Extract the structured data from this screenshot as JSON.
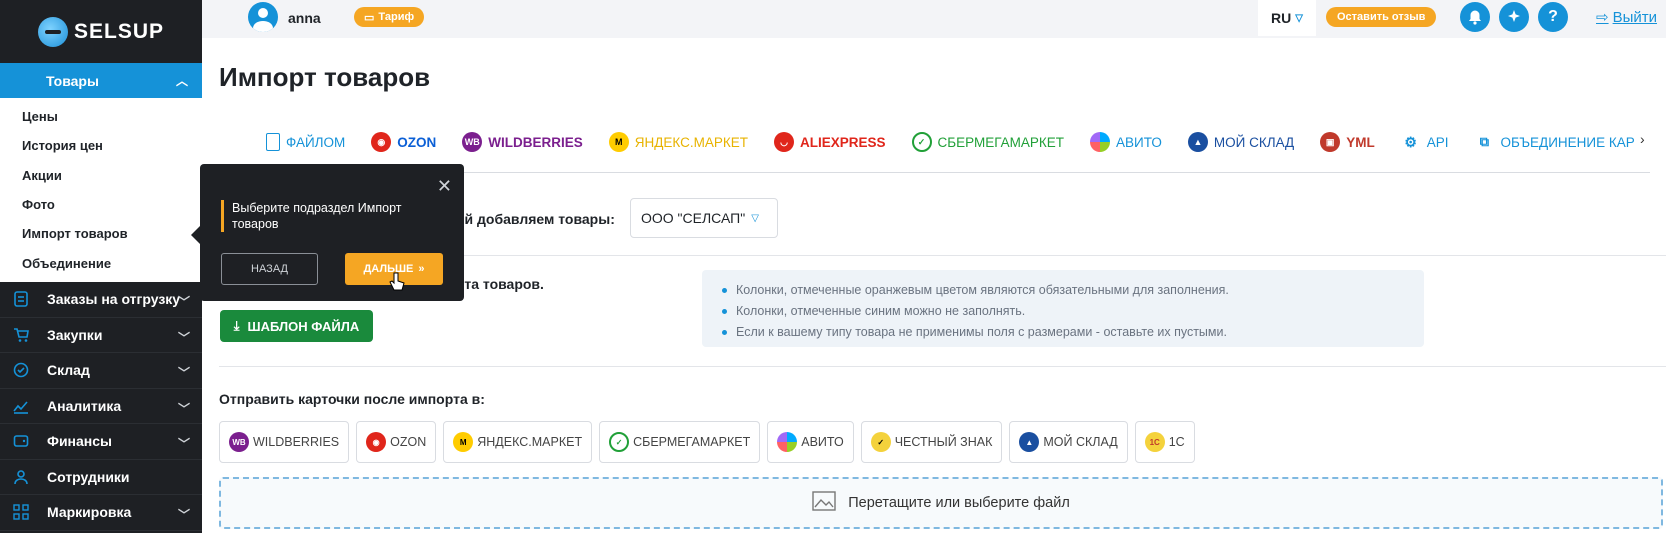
{
  "brand": {
    "name": "SELSUP"
  },
  "sidebar": {
    "active": {
      "label": "Товары"
    },
    "submenu": [
      "Цены",
      "История цен",
      "Акции",
      "Фото",
      "Импорт товаров",
      "Объединение"
    ],
    "items": [
      {
        "label": "Заказы на отгрузку",
        "icon": "orders-icon"
      },
      {
        "label": "Закупки",
        "icon": "cart-icon"
      },
      {
        "label": "Склад",
        "icon": "warehouse-icon"
      },
      {
        "label": "Аналитика",
        "icon": "analytics-icon"
      },
      {
        "label": "Финансы",
        "icon": "wallet-icon"
      },
      {
        "label": "Сотрудники",
        "icon": "user-icon"
      },
      {
        "label": "Маркировка",
        "icon": "marking-icon"
      }
    ]
  },
  "topbar": {
    "username": "anna",
    "tariff_label": "Тариф",
    "lang": "RU",
    "review_label": "Оставить отзыв",
    "logout_label": "Выйти"
  },
  "page": {
    "title": "Импорт товаров",
    "tabs": [
      {
        "label": "ФАЙЛОМ",
        "color": "#1592d8",
        "icon": "file-icon"
      },
      {
        "label": "OZON",
        "color": "#0b5fd6",
        "icon": "ozon-icon"
      },
      {
        "label": "WILDBERRIES",
        "color": "#7b1f8e",
        "icon": "wildberries-icon"
      },
      {
        "label": "ЯНДЕКС.МАРКЕТ",
        "color": "#e8b300",
        "icon": "yandex-market-icon"
      },
      {
        "label": "ALIEXPRESS",
        "color": "#e0261b",
        "icon": "aliexpress-icon"
      },
      {
        "label": "СБЕРМЕГАМАРКЕТ",
        "color": "#21a038",
        "icon": "sbermegamarket-icon"
      },
      {
        "label": "АВИТО",
        "color": "#1592d8",
        "icon": "avito-icon"
      },
      {
        "label": "МОЙ СКЛАД",
        "color": "#1a4fa0",
        "icon": "moysklad-icon"
      },
      {
        "label": "YML",
        "color": "#c0392b",
        "icon": "yml-icon"
      },
      {
        "label": "API",
        "color": "#1592d8",
        "icon": "api-icon"
      },
      {
        "label": "ОБЪЕДИНЕНИЕ КАР",
        "color": "#1592d8",
        "icon": "merge-icon"
      }
    ],
    "org_label": "ой добавляем товары:",
    "org_value": "ООО \"СЕЛСАП\"",
    "template_label": "рта товаров.",
    "template_button": "ШАБЛОН ФАЙЛА",
    "info": [
      "Колонки, отмеченные оранжевым цветом являются обязательными для заполнения.",
      "Колонки, отмеченные синим можно не заполнять.",
      "Если к вашему типу товара не применимы поля с размерами - оставьте их пустыми."
    ],
    "send_label": "Отправить карточки после импорта в:",
    "send_targets": [
      {
        "label": "WILDBERRIES",
        "icon": "wildberries-icon"
      },
      {
        "label": "OZON",
        "icon": "ozon-icon"
      },
      {
        "label": "ЯНДЕКС.МАРКЕТ",
        "icon": "yandex-market-icon"
      },
      {
        "label": "СБЕРМЕГАМАРКЕТ",
        "icon": "sbermegamarket-icon"
      },
      {
        "label": "АВИТО",
        "icon": "avito-icon"
      },
      {
        "label": "ЧЕСТНЫЙ ЗНАК",
        "icon": "chestny-znak-icon"
      },
      {
        "label": "МОЙ СКЛАД",
        "icon": "moysklad-icon"
      },
      {
        "label": "1С",
        "icon": "1c-icon"
      }
    ],
    "dropzone_label": "Перетащите или выберите файл"
  },
  "tooltip": {
    "text": "Выберите подраздел Импорт товаров",
    "back_label": "НАЗАД",
    "next_label": "ДАЛЬШЕ"
  },
  "colors": {
    "accent": "#1592d8",
    "orange": "#f5a623",
    "green": "#1a8a3c",
    "sidebar_bg": "#1e2024"
  }
}
